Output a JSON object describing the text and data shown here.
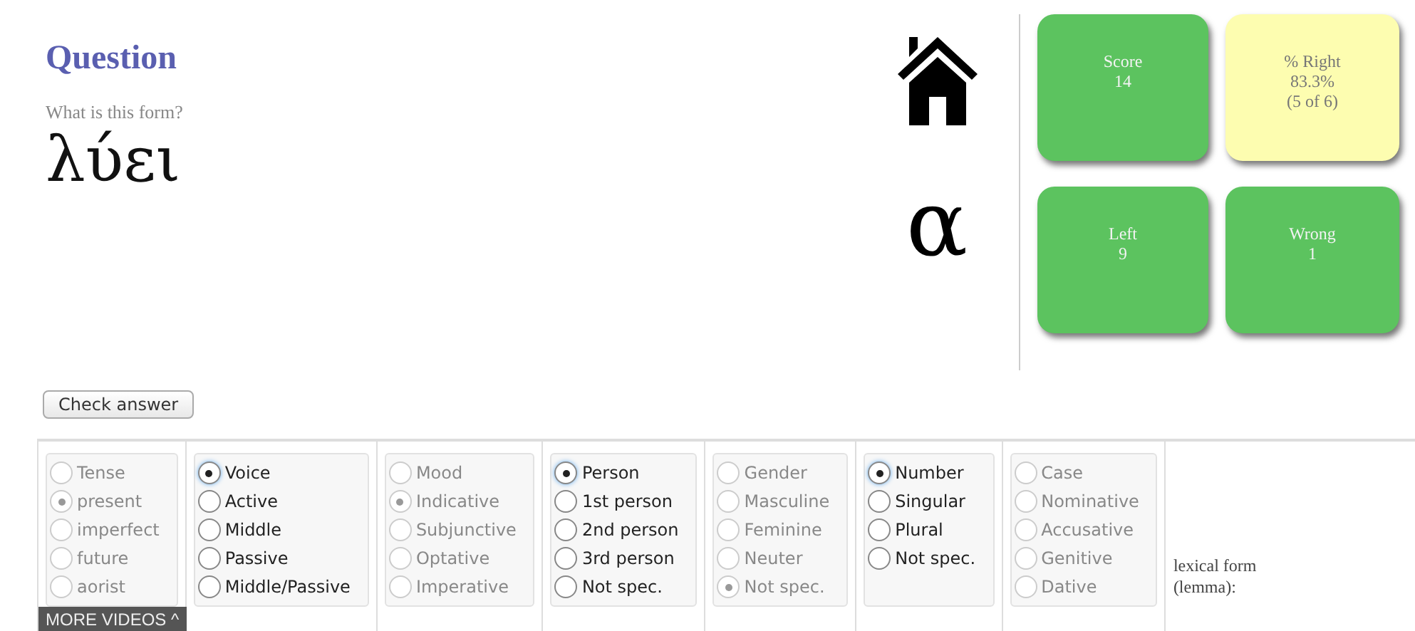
{
  "question": {
    "title": "Question",
    "prompt": "What is this form?",
    "word": "λύει"
  },
  "letter": "α",
  "tiles": [
    {
      "label": "Score",
      "value": "14",
      "kind": "good"
    },
    {
      "label": "% Right",
      "value": "83.3%",
      "note": "(5 of 6)",
      "kind": "info"
    },
    {
      "label": "Left",
      "value": "9",
      "kind": "good"
    },
    {
      "label": "Wrong",
      "value": "1",
      "kind": "good"
    }
  ],
  "check_button": "Check answer",
  "groups": [
    {
      "header": {
        "label": "Tense",
        "selected": false
      },
      "enabled": false,
      "options": [
        {
          "label": "present",
          "selected": true
        },
        {
          "label": "imperfect",
          "selected": false
        },
        {
          "label": "future",
          "selected": false
        },
        {
          "label": "aorist",
          "selected": false
        }
      ]
    },
    {
      "header": {
        "label": "Voice",
        "selected": true
      },
      "enabled": true,
      "options": [
        {
          "label": "Active",
          "selected": false
        },
        {
          "label": "Middle",
          "selected": false
        },
        {
          "label": "Passive",
          "selected": false
        },
        {
          "label": "Middle/Passive",
          "selected": false
        }
      ]
    },
    {
      "header": {
        "label": "Mood",
        "selected": false
      },
      "enabled": false,
      "options": [
        {
          "label": "Indicative",
          "selected": true
        },
        {
          "label": "Subjunctive",
          "selected": false
        },
        {
          "label": "Optative",
          "selected": false
        },
        {
          "label": "Imperative",
          "selected": false
        }
      ]
    },
    {
      "header": {
        "label": "Person",
        "selected": true
      },
      "enabled": true,
      "options": [
        {
          "label": "1st person",
          "selected": false
        },
        {
          "label": "2nd person",
          "selected": false
        },
        {
          "label": "3rd person",
          "selected": false
        },
        {
          "label": "Not spec.",
          "selected": false
        }
      ]
    },
    {
      "header": {
        "label": "Gender",
        "selected": false
      },
      "enabled": false,
      "options": [
        {
          "label": "Masculine",
          "selected": false
        },
        {
          "label": "Feminine",
          "selected": false
        },
        {
          "label": "Neuter",
          "selected": false
        },
        {
          "label": "Not spec.",
          "selected": true
        }
      ]
    },
    {
      "header": {
        "label": "Number",
        "selected": true
      },
      "enabled": true,
      "options": [
        {
          "label": "Singular",
          "selected": false
        },
        {
          "label": "Plural",
          "selected": false
        },
        {
          "label": "Not spec.",
          "selected": false
        }
      ]
    },
    {
      "header": {
        "label": "Case",
        "selected": false
      },
      "enabled": false,
      "options": [
        {
          "label": "Nominative",
          "selected": false
        },
        {
          "label": "Accusative",
          "selected": false
        },
        {
          "label": "Genitive",
          "selected": false
        },
        {
          "label": "Dative",
          "selected": false
        }
      ]
    }
  ],
  "lexical_label": "lexical form (lemma):",
  "overlay_button": "MORE VIDEOS ^"
}
